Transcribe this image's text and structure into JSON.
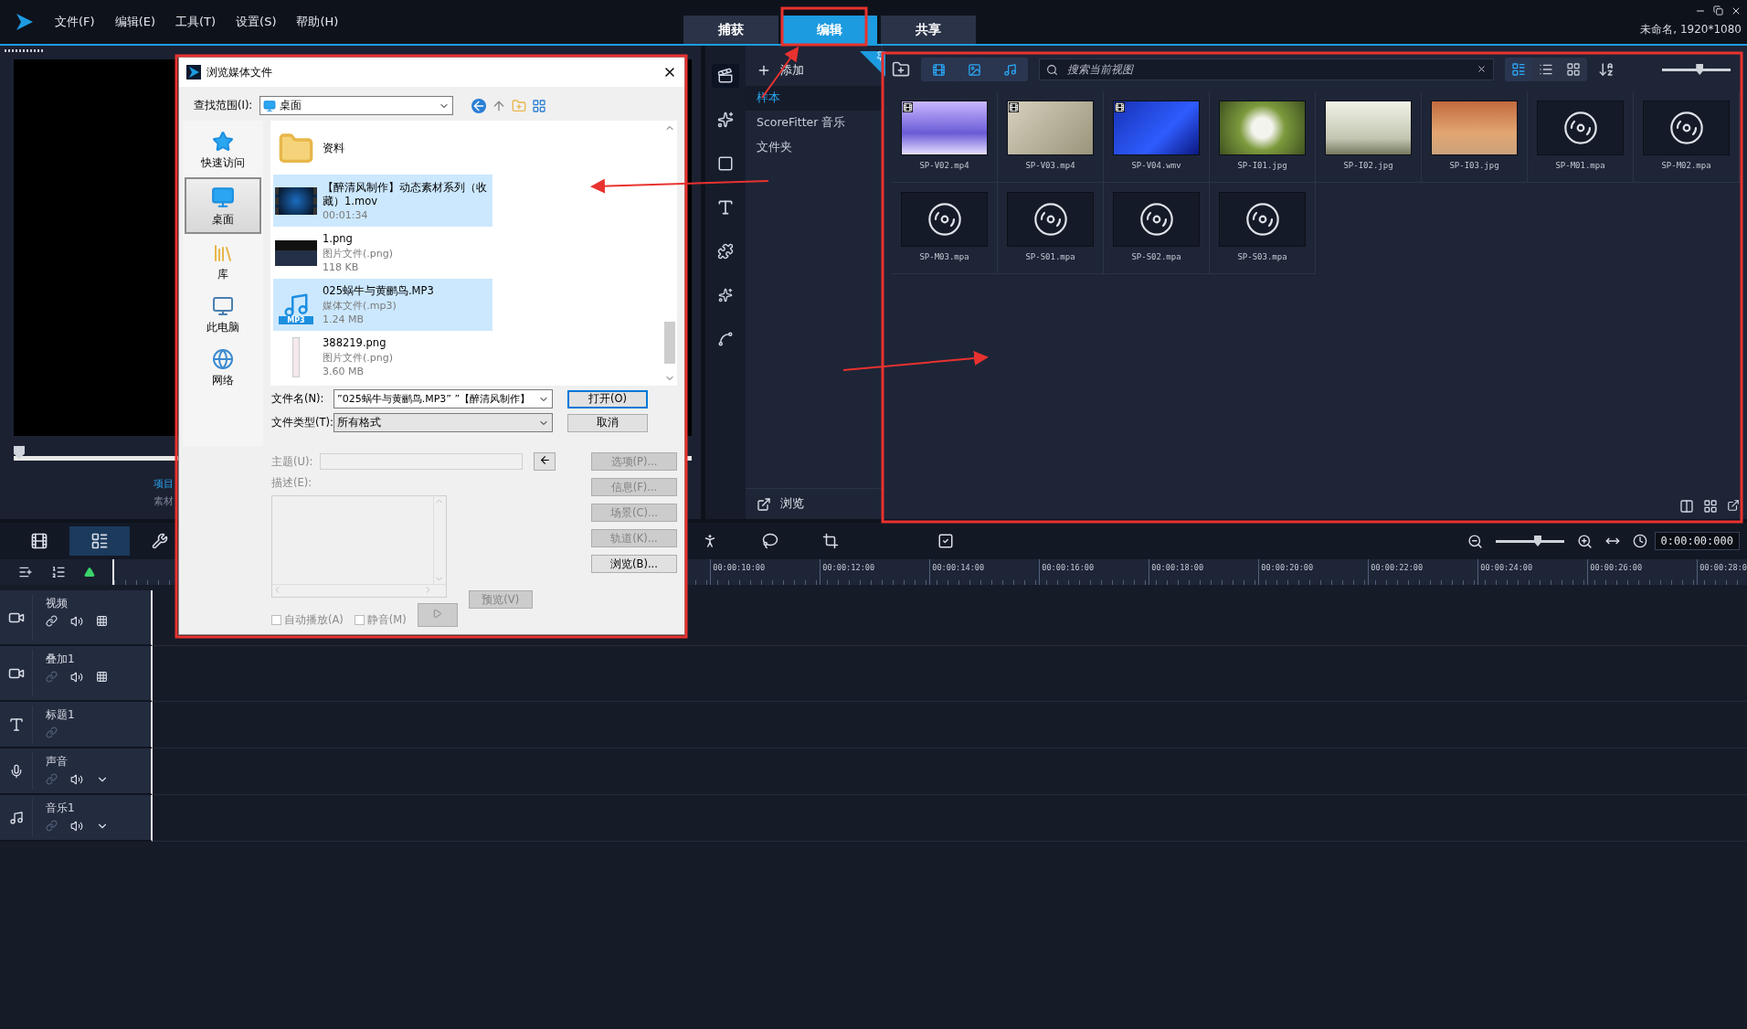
{
  "menu": {
    "items": [
      "文件(F)",
      "编辑(E)",
      "工具(T)",
      "设置(S)",
      "帮助(H)"
    ]
  },
  "mode_tabs": [
    {
      "label": "捕获",
      "selected": false
    },
    {
      "label": "编辑",
      "selected": true
    },
    {
      "label": "共享",
      "selected": false
    }
  ],
  "project_info": "未命名, 1920*1080",
  "player": {
    "tabs": [
      {
        "label": "项目",
        "selected": true
      },
      {
        "label": "素材",
        "selected": false
      }
    ]
  },
  "library": {
    "add_label": "添加",
    "categories": [
      {
        "label": "样本",
        "selected": true
      },
      {
        "label": "ScoreFitter 音乐",
        "selected": false
      },
      {
        "label": "文件夹",
        "selected": false
      }
    ],
    "browse_label": "浏览",
    "media_filters": [
      {
        "kind": "video",
        "selected": true
      },
      {
        "kind": "photo",
        "selected": true
      },
      {
        "kind": "audio",
        "selected": true
      }
    ],
    "search": {
      "placeholder": "搜索当前视图"
    },
    "size_slider": {
      "level": 0.55
    },
    "views": [
      {
        "kind": "thumbnail",
        "selected": true
      },
      {
        "kind": "list",
        "selected": false
      },
      {
        "kind": "grid",
        "selected": false
      }
    ],
    "items": [
      {
        "name": "SP-V02.mp4",
        "kind": "video"
      },
      {
        "name": "SP-V03.mp4",
        "kind": "video"
      },
      {
        "name": "SP-V04.wmv",
        "kind": "video"
      },
      {
        "name": "SP-I01.jpg",
        "kind": "photo"
      },
      {
        "name": "SP-I02.jpg",
        "kind": "photo"
      },
      {
        "name": "SP-I03.jpg",
        "kind": "photo"
      },
      {
        "name": "SP-M01.mpa",
        "kind": "audio"
      },
      {
        "name": "SP-M02.mpa",
        "kind": "audio"
      },
      {
        "name": "SP-M03.mpa",
        "kind": "audio"
      },
      {
        "name": "SP-S01.mpa",
        "kind": "audio"
      },
      {
        "name": "SP-S02.mpa",
        "kind": "audio"
      },
      {
        "name": "SP-S03.mpa",
        "kind": "audio"
      }
    ]
  },
  "timeline": {
    "ruler_ticks": [
      "00:00:10:00",
      "00:00:12:00",
      "00:00:14:00",
      "00:00:16:00",
      "00:00:18:00",
      "00:00:20:00",
      "00:00:22:00",
      "00:00:24:00",
      "00:00:26:00",
      "00:00:28:0"
    ],
    "zoom": {
      "level": 0.62
    },
    "timecode": "0:00:00:000",
    "tracks": [
      {
        "name": "视频",
        "kind": "video"
      },
      {
        "name": "叠加1",
        "kind": "overlay"
      },
      {
        "name": "标题1",
        "kind": "title"
      },
      {
        "name": "声音",
        "kind": "voice"
      },
      {
        "name": "音乐1",
        "kind": "music"
      }
    ]
  },
  "dialog": {
    "title": "浏览媒体文件",
    "look_in_label": "查找范围(I):",
    "look_in_value": "桌面",
    "places": [
      {
        "label": "快速访问",
        "kind": "quick",
        "selected": false
      },
      {
        "label": "桌面",
        "kind": "desktop",
        "selected": true
      },
      {
        "label": "库",
        "kind": "library",
        "selected": false
      },
      {
        "label": "此电脑",
        "kind": "computer",
        "selected": false
      },
      {
        "label": "网络",
        "kind": "network",
        "selected": false
      }
    ],
    "files": [
      {
        "name": "资料",
        "kind": "folder",
        "selected": false
      },
      {
        "name": "【醉清风制作】动态素材系列（收藏）1.mov",
        "detail": "00:01:34",
        "kind": "video",
        "selected": true
      },
      {
        "name": "1.png",
        "type": "图片文件(.png)",
        "detail": "118 KB",
        "kind": "image",
        "selected": false
      },
      {
        "name": "025蜗牛与黄鹂鸟.MP3",
        "type": "媒体文件(.mp3)",
        "detail": "1.24 MB",
        "kind": "audio",
        "badge": "MP3",
        "selected": true
      },
      {
        "name": "388219.png",
        "type": "图片文件(.png)",
        "detail": "3.60 MB",
        "kind": "tall-image",
        "selected": false
      }
    ],
    "filename_label": "文件名(N):",
    "filename_value": "”025蜗牛与黄鹂鸟.MP3” ”【醉清风制作】",
    "filetype_label": "文件类型(T):",
    "filetype_value": "所有格式",
    "open_button": "打开(O)",
    "cancel_button": "取消",
    "subject_label": "主题(U):",
    "description_label": "描述(E):",
    "side_buttons": [
      {
        "label": "选项(P)...",
        "disabled": true
      },
      {
        "label": "信息(F)...",
        "disabled": true
      },
      {
        "label": "场景(C)...",
        "disabled": true
      },
      {
        "label": "轨道(K)...",
        "disabled": true
      },
      {
        "label": "浏览(B)...",
        "disabled": false
      }
    ],
    "autoplay": {
      "label": "自动播放(A)",
      "checked": false
    },
    "mute": {
      "label": "静音(M)",
      "checked": false
    },
    "preview_button": "预览(V)"
  }
}
